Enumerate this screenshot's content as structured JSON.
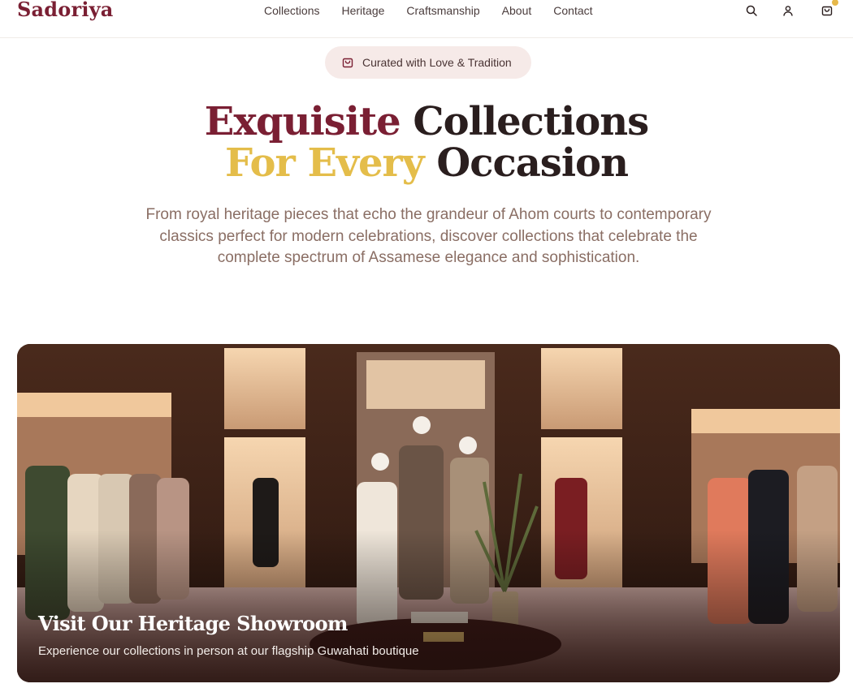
{
  "brand": {
    "name": "Sadoriya"
  },
  "nav": {
    "items": [
      "Collections",
      "Heritage",
      "Craftsmanship",
      "About",
      "Contact"
    ]
  },
  "header_icons": [
    "search-icon",
    "user-icon",
    "shopping-bag-icon"
  ],
  "badge": {
    "icon": "shopping-bag-icon",
    "text": "Curated with Love & Tradition"
  },
  "hero": {
    "line1_word1": "Exquisite",
    "line1_word2": "Collections",
    "line2_word1": "For Every",
    "line2_word2": "Occasion",
    "description": "From royal heritage pieces that echo the grandeur of Ahom courts to contemporary classics perfect for modern celebrations, discover collections that celebrate the complete spectrum of Assamese elegance and sophistication."
  },
  "showroom": {
    "title": "Visit Our Heritage Showroom",
    "subtitle": "Experience our collections in person at our flagship Guwahati boutique"
  },
  "colors": {
    "brand_maroon": "#7a1f33",
    "accent_gold": "#e4bd4a",
    "text_dark": "#2a1e1e",
    "text_muted": "#8a6e64",
    "badge_bg": "#f6eae8"
  }
}
